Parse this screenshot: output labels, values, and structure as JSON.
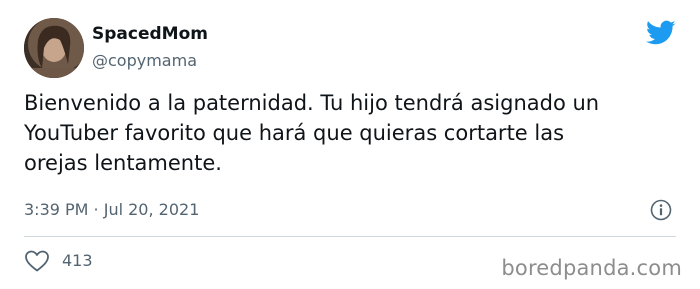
{
  "author": {
    "display_name": "SpacedMom",
    "handle": "@copymama"
  },
  "tweet": {
    "text": "Bienvenido a la paternidad. Tu hijo tendrá asignado un\nYouTuber favorito que hará que quieras cortarte las\norejas lentamente.",
    "timestamp": "3:39 PM · Jul 20, 2021",
    "likes": "413"
  },
  "icons": {
    "brand": "twitter-bird-icon",
    "info": "info-icon",
    "like": "heart-icon"
  },
  "colors": {
    "twitter_blue": "#1d9bf0",
    "text_primary": "#0f1419",
    "text_secondary": "#536471",
    "divider": "#cfd9de",
    "watermark": "#8d8d8d"
  },
  "watermark": "boredpanda.com"
}
